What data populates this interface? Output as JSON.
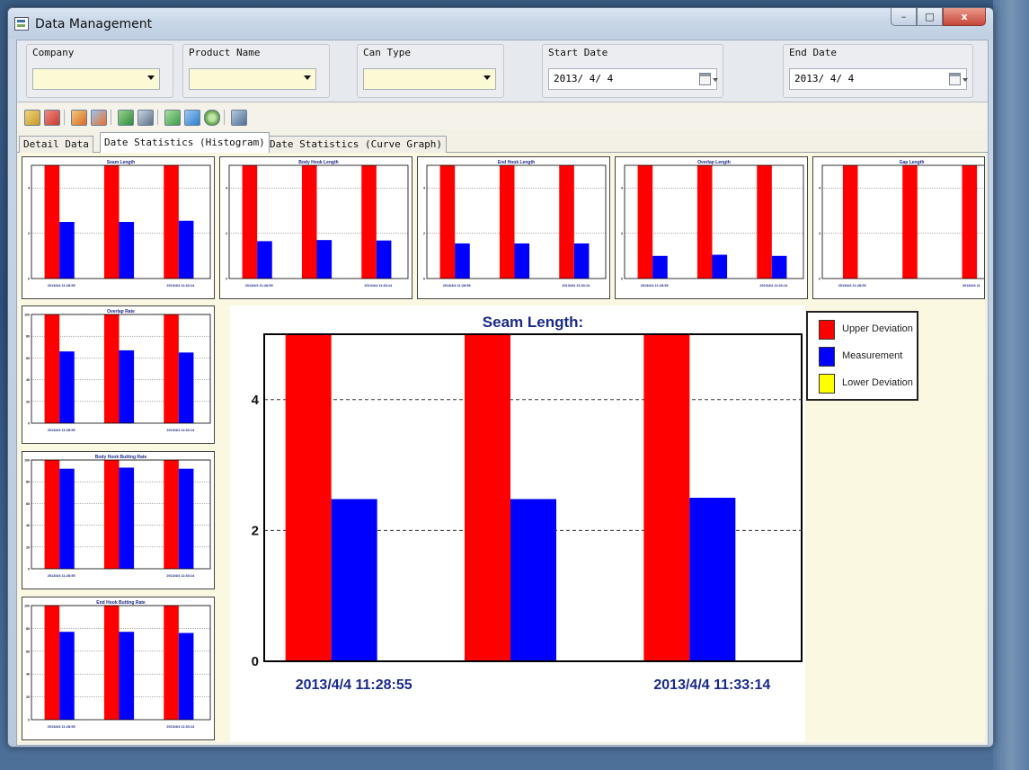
{
  "window": {
    "title": "Data Management",
    "min_label": "–",
    "max_label": "□",
    "close_label": "x"
  },
  "filters": {
    "company": {
      "label": "Company",
      "value": ""
    },
    "product": {
      "label": "Product Name",
      "value": ""
    },
    "can_type": {
      "label": "Can Type",
      "value": ""
    },
    "start_date": {
      "label": "Start Date",
      "value": "2013/ 4/ 4"
    },
    "end_date": {
      "label": "End Date",
      "value": "2013/ 4/ 4"
    }
  },
  "toolbar_icons": [
    "new-record-icon",
    "delete-record-icon",
    "edit-icon",
    "edit-save-icon",
    "export-excel-icon",
    "print-icon",
    "refresh-icon",
    "import-icon",
    "settings-icon",
    "window-icon"
  ],
  "tabs": [
    {
      "label": "Detail Data",
      "active": false
    },
    {
      "label": "Date Statistics (Histogram)",
      "active": true
    },
    {
      "label": "Date Statistics (Curve Graph)",
      "active": false
    }
  ],
  "colors": {
    "upper": "#ff0000",
    "measurement": "#0000ff",
    "lower": "#ffff00"
  },
  "legend": [
    "Upper Deviation",
    "Measurement",
    "Lower Deviation"
  ],
  "chart_data": [
    {
      "type": "bar",
      "title": "Seam Length:",
      "categories": [
        "2013/4/4 11:28:55",
        "",
        "2013/4/4 11:33:14"
      ],
      "ylim": [
        0,
        5
      ],
      "yticks": [
        0,
        2,
        4
      ],
      "grid": true,
      "series": [
        {
          "name": "Upper Deviation",
          "values": [
            5.2,
            5.2,
            5.2
          ]
        },
        {
          "name": "Measurement",
          "values": [
            2.48,
            2.48,
            2.5
          ]
        }
      ]
    },
    {
      "type": "bar",
      "title": "Seam Length",
      "categories": [
        "2013/4/4 11:28:55",
        "",
        "2013/4/4 11:33:14"
      ],
      "ylim": [
        0,
        5
      ],
      "yticks": [
        0,
        2,
        4
      ],
      "series": [
        {
          "name": "Upper Deviation",
          "values": [
            5.2,
            5.2,
            5.2
          ]
        },
        {
          "name": "Measurement",
          "values": [
            2.5,
            2.5,
            2.55
          ]
        }
      ]
    },
    {
      "type": "bar",
      "title": "Body Hook Length",
      "categories": [
        "2013/4/4 11:28:55",
        "",
        "2013/4/4 11:33:14"
      ],
      "ylim": [
        0,
        5
      ],
      "yticks": [
        0,
        2,
        4
      ],
      "series": [
        {
          "name": "Upper Deviation",
          "values": [
            5.2,
            5.2,
            5.2
          ]
        },
        {
          "name": "Measurement",
          "values": [
            1.65,
            1.7,
            1.68
          ]
        }
      ]
    },
    {
      "type": "bar",
      "title": "End Hook Length",
      "categories": [
        "2013/4/4 11:28:55",
        "",
        "2013/4/4 11:33:14"
      ],
      "ylim": [
        0,
        5
      ],
      "yticks": [
        0,
        2,
        4
      ],
      "series": [
        {
          "name": "Upper Deviation",
          "values": [
            5.2,
            5.2,
            5.2
          ]
        },
        {
          "name": "Measurement",
          "values": [
            1.55,
            1.55,
            1.55
          ]
        }
      ]
    },
    {
      "type": "bar",
      "title": "Overlap Length",
      "categories": [
        "2013/4/4 11:28:55",
        "",
        "2013/4/4 11:33:14"
      ],
      "ylim": [
        0,
        5
      ],
      "yticks": [
        0,
        2,
        4
      ],
      "series": [
        {
          "name": "Upper Deviation",
          "values": [
            5.2,
            5.2,
            5.2
          ]
        },
        {
          "name": "Measurement",
          "values": [
            1.0,
            1.05,
            1.0
          ]
        }
      ]
    },
    {
      "type": "bar",
      "title": "Gap Length",
      "categories": [
        "2013/4/4 11:28:55",
        "",
        "2013/4/4 11"
      ],
      "ylim": [
        0,
        5
      ],
      "yticks": [
        0,
        2,
        4
      ],
      "series": [
        {
          "name": "Upper Deviation",
          "values": [
            5.2,
            5.2,
            5.2
          ]
        }
      ]
    },
    {
      "type": "bar",
      "title": "Overlap Rate",
      "categories": [
        "2013/4/4 11:28:55",
        "",
        "2013/4/4 11:33:14"
      ],
      "ylim": [
        0,
        100
      ],
      "yticks": [
        0,
        20,
        40,
        60,
        80,
        100
      ],
      "series": [
        {
          "name": "Upper Deviation",
          "values": [
            104,
            104,
            104
          ]
        },
        {
          "name": "Measurement",
          "values": [
            66,
            67,
            65
          ]
        }
      ]
    },
    {
      "type": "bar",
      "title": "Body Hook Butting Rate",
      "categories": [
        "2013/4/4 11:28:55",
        "",
        "2013/4/4 11:33:14"
      ],
      "ylim": [
        0,
        100
      ],
      "yticks": [
        0,
        20,
        40,
        60,
        80,
        100
      ],
      "series": [
        {
          "name": "Upper Deviation",
          "values": [
            104,
            104,
            104
          ]
        },
        {
          "name": "Measurement",
          "values": [
            92,
            93,
            92
          ]
        }
      ]
    },
    {
      "type": "bar",
      "title": "End Hook Butting Rate",
      "categories": [
        "2013/4/4 11:28:55",
        "",
        "2013/4/4 11:33:14"
      ],
      "ylim": [
        0,
        100
      ],
      "yticks": [
        0,
        20,
        40,
        60,
        80,
        100
      ],
      "series": [
        {
          "name": "Upper Deviation",
          "values": [
            104,
            104,
            104
          ]
        },
        {
          "name": "Measurement",
          "values": [
            77,
            77,
            76
          ]
        }
      ]
    }
  ]
}
